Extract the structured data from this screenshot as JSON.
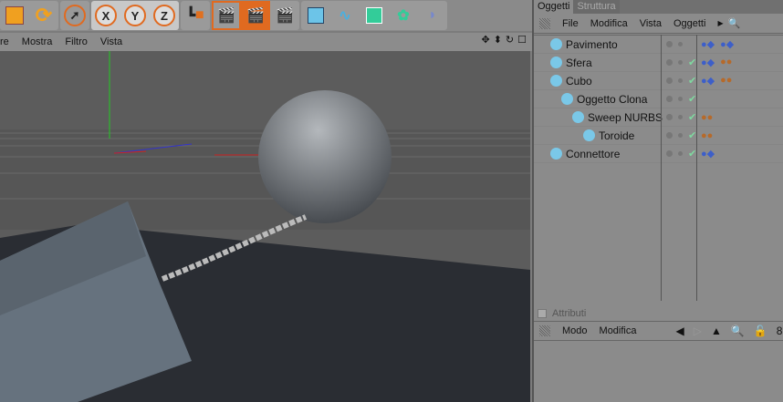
{
  "toolbar": {
    "buttons": [
      "scale-icon",
      "rotate-icon",
      "select-icon",
      "X",
      "Y",
      "Z",
      "coordinate-system-icon",
      "render-view-icon",
      "render-picture-viewer-icon",
      "render-settings-icon",
      "cube-icon",
      "spline-icon",
      "nurbs-icon",
      "array-icon",
      "deformer-icon"
    ]
  },
  "viewport": {
    "menu": [
      "re",
      "Mostra",
      "Filtro",
      "Vista"
    ],
    "nav_icons": [
      "move-icon",
      "zoom-icon",
      "rotate-view-icon",
      "maximize-icon"
    ]
  },
  "objects_panel": {
    "tabs": [
      "Oggetti",
      "Struttura"
    ],
    "menu": [
      "File",
      "Modifica",
      "Vista",
      "Oggetti"
    ],
    "objects": [
      {
        "name": "Pavimento",
        "level": 0,
        "check": false,
        "tags": [
          "texture",
          "phong"
        ]
      },
      {
        "name": "Sfera",
        "level": 0,
        "check": true,
        "tags": [
          "texture",
          "material"
        ]
      },
      {
        "name": "Cubo",
        "level": 0,
        "check": true,
        "tags": [
          "texture",
          "material"
        ]
      },
      {
        "name": "Oggetto Clona",
        "level": 1,
        "check": true,
        "tags": []
      },
      {
        "name": "Sweep NURBS",
        "level": 2,
        "check": true,
        "tags": [
          "material"
        ]
      },
      {
        "name": "Toroide",
        "level": 3,
        "check": true,
        "tags": [
          "material"
        ]
      },
      {
        "name": "Connettore",
        "level": 0,
        "check": true,
        "tags": [
          "texture"
        ]
      }
    ]
  },
  "attributes_panel": {
    "title": "Attributi",
    "menu": [
      "Modo",
      "Modifica"
    ]
  },
  "colors": {
    "accent": "#e06a20",
    "check": "#7fd9a0"
  }
}
